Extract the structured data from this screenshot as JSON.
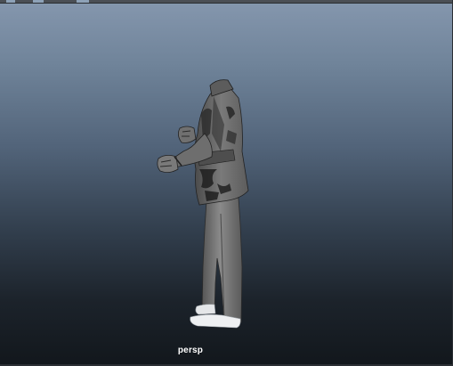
{
  "viewport": {
    "camera_name": "persp",
    "gradient_top": "#8597ae",
    "gradient_bottom": "#12171c"
  },
  "scene": {
    "object_icon": "suit-mannequin-icon",
    "shading_color": "#6b6b6b"
  }
}
